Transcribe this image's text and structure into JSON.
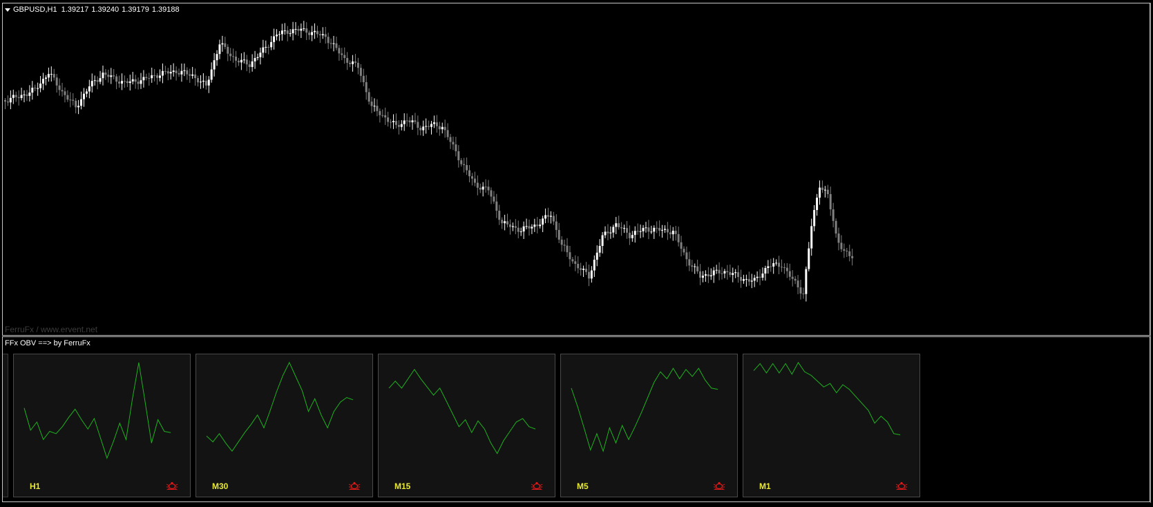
{
  "chart": {
    "symbol": "GBPUSD,H1",
    "quotes": [
      "1.39217",
      "1.39240",
      "1.39179",
      "1.39188"
    ],
    "watermark": "FerruFx / www.ervent.net",
    "bull_color": "#ffffff",
    "bear_color": "#808080",
    "background": "#000000"
  },
  "indicator": {
    "title": "FFx OBV ==> by FerruFx",
    "line_color": "#1db31d",
    "label_color": "#e8e838",
    "alert_icon": "bug-icon",
    "alert_color": "#e01818",
    "panels": [
      {
        "label": "H1",
        "values": [
          57,
          38,
          45,
          30,
          37,
          35,
          41,
          49,
          56,
          47,
          39,
          48,
          31,
          14,
          28,
          44,
          30,
          65,
          96,
          62,
          27,
          47,
          37,
          36
        ]
      },
      {
        "label": "M30",
        "values": [
          33,
          28,
          35,
          27,
          20,
          28,
          36,
          43,
          51,
          40,
          55,
          71,
          85,
          96,
          84,
          72,
          54,
          65,
          51,
          40,
          54,
          62,
          66,
          64
        ]
      },
      {
        "label": "M15",
        "values": [
          74,
          80,
          74,
          82,
          90,
          82,
          75,
          68,
          74,
          63,
          52,
          41,
          47,
          36,
          46,
          39,
          27,
          18,
          29,
          37,
          45,
          48,
          41,
          39
        ]
      },
      {
        "label": "M5",
        "values": [
          74,
          58,
          40,
          21,
          35,
          20,
          40,
          27,
          42,
          30,
          41,
          53,
          66,
          79,
          88,
          82,
          91,
          82,
          90,
          84,
          91,
          81,
          74,
          73
        ]
      },
      {
        "label": "M1",
        "values": [
          89,
          95,
          87,
          95,
          87,
          95,
          86,
          96,
          88,
          85,
          80,
          75,
          78,
          70,
          77,
          73,
          67,
          61,
          55,
          44,
          50,
          45,
          35,
          34
        ]
      }
    ]
  }
}
